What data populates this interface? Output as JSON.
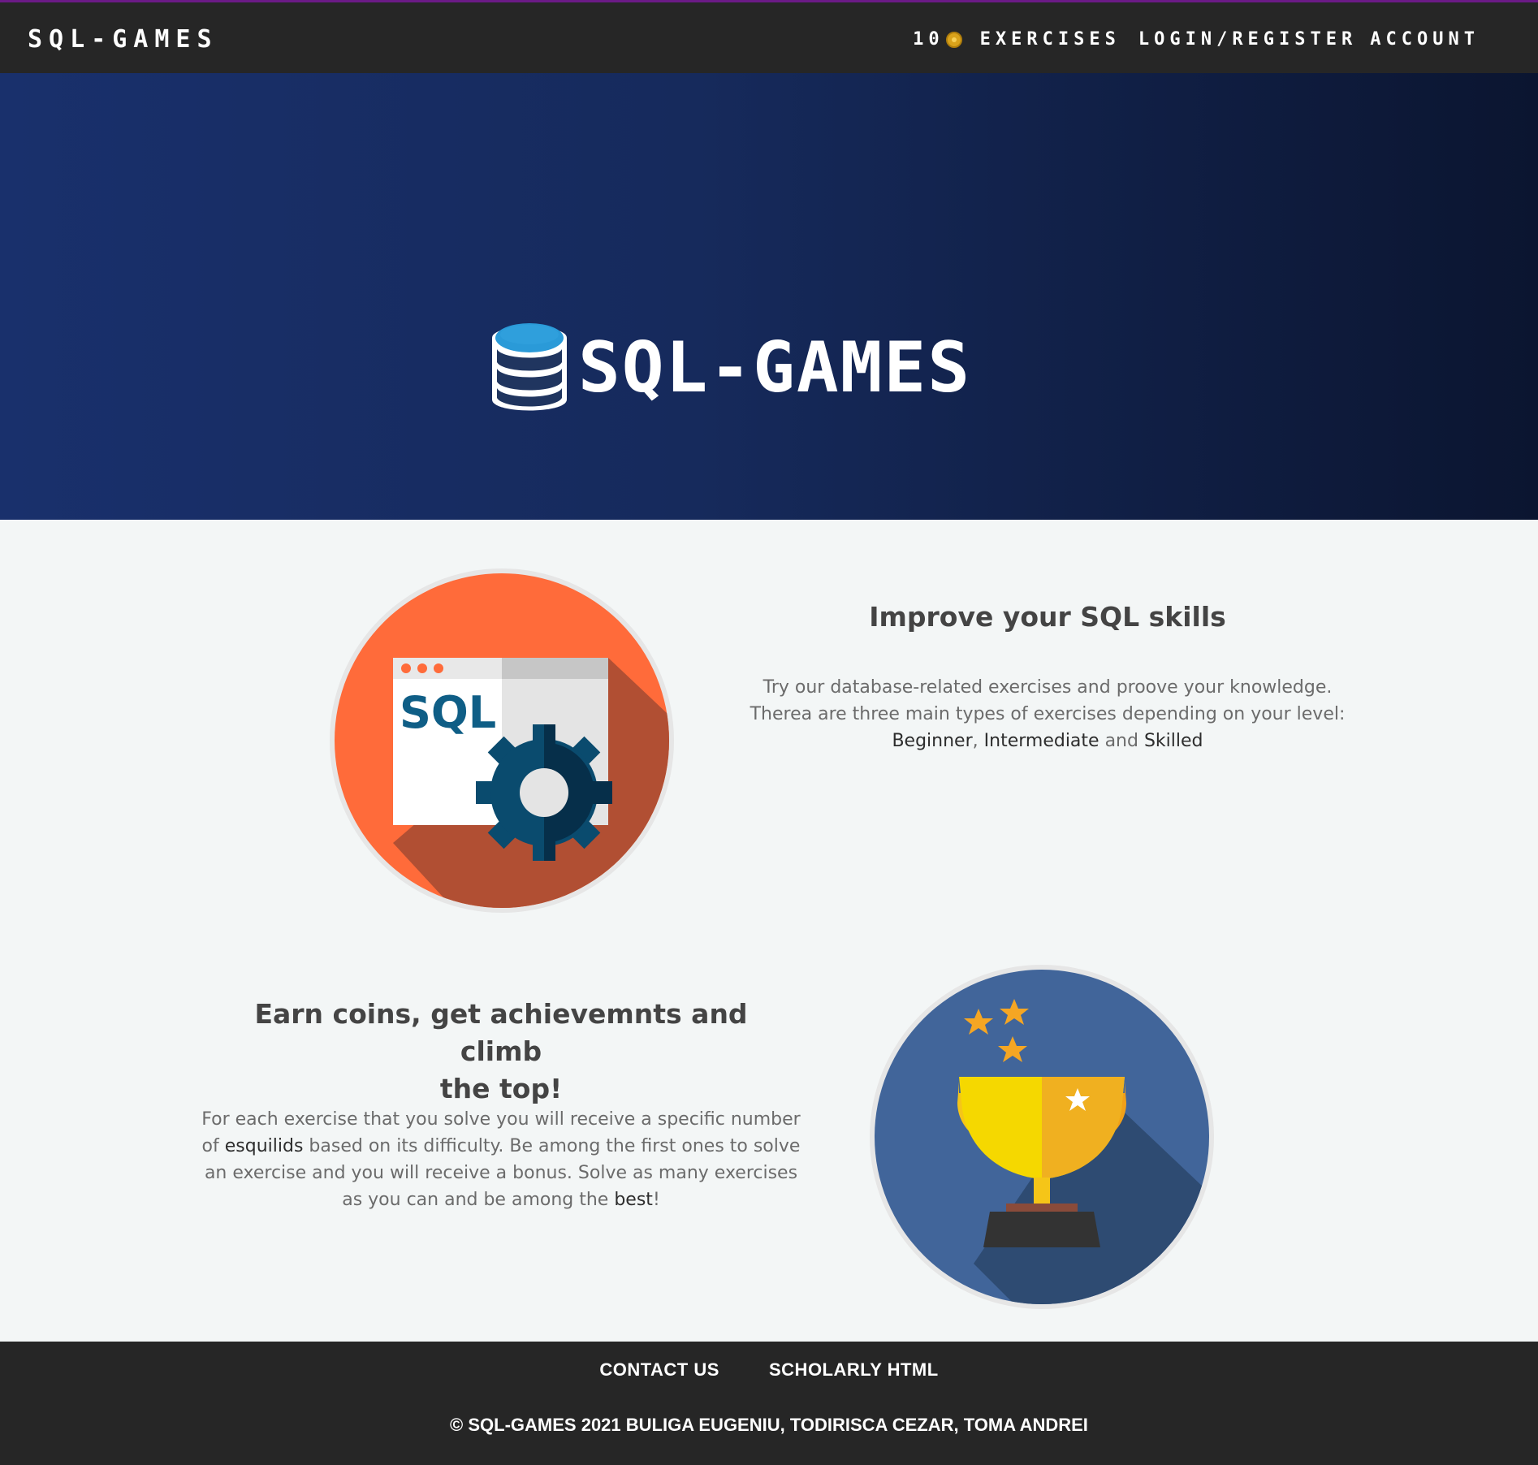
{
  "header": {
    "brand": "SQL-GAMES",
    "coins": "10",
    "nav": [
      "EXERCISES",
      "LOGIN/REGISTER",
      "ACCOUNT"
    ]
  },
  "hero": {
    "title": "SQL-GAMES"
  },
  "section1": {
    "heading": "Improve your SQL skills",
    "line1": "Try our database-related exercises and proove your knowledge.",
    "line2": "Therea are three main types of exercises depending on your level:",
    "level1": "Beginner",
    "comma": ",",
    "level2": "Intermediate",
    "and": "and",
    "level3": "Skilled",
    "image_text": "SQL"
  },
  "section2": {
    "heading_line1": "Earn coins, get achievemnts and climb",
    "heading_line2": "the top!",
    "p_a": "For each exercise that you solve you will receive a specific number",
    "p_b1": "of ",
    "p_b_hl": "esquilids",
    "p_b2": " based on its difficulty. Be among the first ones to solve",
    "p_c": "an exercise and you will receive a bonus. Solve as many exercises",
    "p_d1": "as you can and be among the ",
    "p_d_hl": "best",
    "p_d2": "!"
  },
  "footer": {
    "links": [
      "CONTACT US",
      "SCHOLARLY HTML"
    ],
    "copyright": "© SQL-GAMES 2021 BULIGA EUGENIU, TODIRISCA CEZAR, TOMA ANDREI"
  },
  "colors": {
    "topbar": "#262626",
    "hero_start": "#19306c",
    "hero_end": "#0b1530",
    "page_bg": "#f3f6f6",
    "orange": "#ff6b3a",
    "blue_circle": "#41659a",
    "gold": "#f5c518"
  }
}
